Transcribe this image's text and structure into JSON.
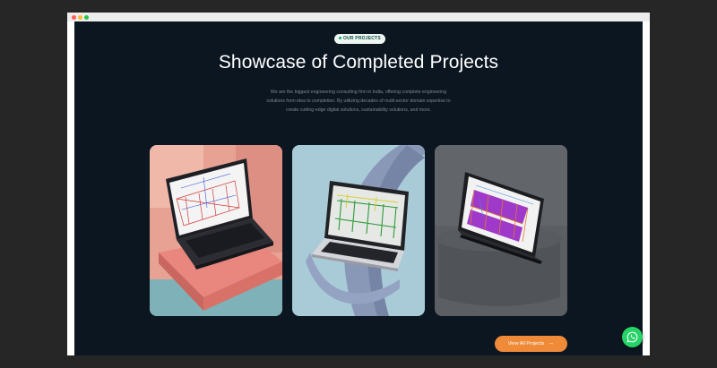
{
  "section": {
    "badge": "OUR PROJECTS",
    "title": "Showcase of Completed Projects",
    "description_lines": [
      "We are the biggest engineering consulting firm in India, offering complete engineering",
      "solutions from idea to completion. By utilizing decades of multi-sector domain expertise to",
      "create cutting-edge digital solutions, sustainability solutions, and more."
    ]
  },
  "projects": [
    {
      "image": "laptop showing steel truss structural drawing on pink pedestal"
    },
    {
      "image": "laptop showing green steel frame model on blue curved background"
    },
    {
      "image": "laptop showing purple 3D steel structure model on grey stand"
    }
  ],
  "cta": {
    "label": "View All Projects"
  },
  "icons": {
    "cta_arrow": "arrow-right-icon",
    "whatsapp": "whatsapp-icon"
  },
  "colors": {
    "page_bg": "#0c1621",
    "accent": "#ee8a38",
    "badge_dot": "#17a673",
    "whatsapp": "#25d366"
  }
}
